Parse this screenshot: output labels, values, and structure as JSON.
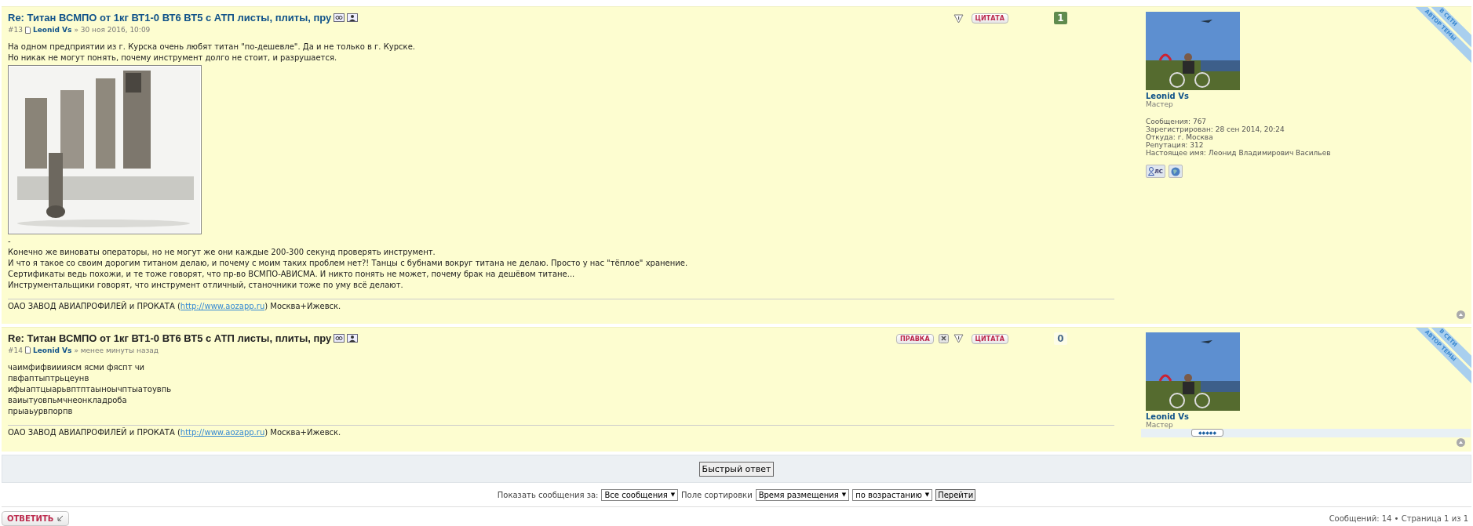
{
  "posts": [
    {
      "title": "Re: Титан ВСМПО от 1кг ВТ1-0 ВТ6 ВТ5 с АТП листы, плиты, пру",
      "title_highlighted": true,
      "number": "#13",
      "author": "Leonid Vs",
      "date": "» 30 ноя 2016, 10:09",
      "actions": [
        {
          "kind": "report"
        },
        {
          "kind": "quote",
          "label": "ЦИТАТА"
        }
      ],
      "score": {
        "text": "1",
        "positive": true
      },
      "body": [
        {
          "kind": "text",
          "text": "На одном предприятии из г. Курска очень любят титан \"по-дешевле\". Да и не только в г. Курске."
        },
        {
          "kind": "text",
          "text": "Но никак не могут понять, почему инструмент долго не стоит, и разрушается."
        },
        {
          "kind": "picture"
        },
        {
          "kind": "gap"
        },
        {
          "kind": "text",
          "text": "-"
        },
        {
          "kind": "text",
          "text": "Конечно же виноваты операторы, но не могут же они каждые 200-300 секунд проверять инструмент."
        },
        {
          "kind": "text",
          "text": "И что я такое со своим дорогим титаном делаю, и почему с моим таких проблем нет?! Танцы с бубнами вокруг титана не делаю. Просто у нас \"тёплое\" хранение."
        },
        {
          "kind": "text",
          "text": "Сертификаты ведь похожи, и те тоже говорят, что пр-во ВСМПО-АВИСМА. И никто понять не может, почему брак на дешёвом титане..."
        },
        {
          "kind": "text",
          "text": "Инструментальщики говорят, что инструмент отличный, станочники тоже по уму всё делают."
        }
      ],
      "signature": {
        "before": "ОАО ЗАВОД АВИАПРОФИЛЕЙ и ПРОКАТА (",
        "link": "http://www.aozapp.ru",
        "after": ") Москва+Ижевск."
      },
      "profile": {
        "name": "Leonid Vs",
        "rank": "Мастер",
        "details": [
          "Сообщения: 767",
          "Зарегистрирован: 28 сен 2014, 20:24",
          "Откуда: г. Москва",
          "Репутация: 312",
          "Настоящее имя: Леонид Владимирович Васильев"
        ],
        "contact_buttons": [
          {
            "kind": "pm",
            "label": "ЛС"
          },
          {
            "kind": "web"
          }
        ]
      },
      "ribbon": [
        "В СЕТИ",
        "АВТОР ТЕМЫ"
      ]
    },
    {
      "title": "Re: Титан ВСМПО от 1кг ВТ1-0 ВТ6 ВТ5 с АТП листы, плиты, пру",
      "title_highlighted": false,
      "number": "#14",
      "author": "Leonid Vs",
      "date": "» менее минуты назад",
      "actions": [
        {
          "kind": "edit",
          "label": "ПРАВКА"
        },
        {
          "kind": "delete"
        },
        {
          "kind": "report"
        },
        {
          "kind": "quote",
          "label": "ЦИТАТА"
        }
      ],
      "score": {
        "text": "0",
        "positive": false
      },
      "body": [
        {
          "kind": "text",
          "text": "чаимфифвиииясм ясми фяспт чи"
        },
        {
          "kind": "text",
          "text": "пвфаптыптрьцеунв"
        },
        {
          "kind": "text",
          "text": "ифыаптцыарьвптптаыноычптыатоувпь"
        },
        {
          "kind": "text",
          "text": "ваиытуовпьмчнеонкладроба"
        },
        {
          "kind": "text",
          "text": "прыаьурвпорпв"
        }
      ],
      "signature": {
        "before": "ОАО ЗАВОД АВИАПРОФИЛЕЙ и ПРОКАТА (",
        "link": "http://www.aozapp.ru",
        "after": ") Москва+Ижевск."
      },
      "profile": {
        "name": "Leonid Vs",
        "rank": "Мастер",
        "rating": "◆◆◆◆◆"
      },
      "ribbon": [
        "В СЕТИ",
        "АВТОР ТЕМЫ"
      ]
    }
  ],
  "quick_reply": "Быстрый ответ",
  "sort_bar": {
    "show_label": "Показать сообщения за:",
    "show_value": "Все сообщения",
    "sort_label": "Поле сортировки",
    "sort_value": "Время размещения",
    "order_value": "по возрастанию",
    "go": "Перейти",
    "caret": "▼"
  },
  "reply_button": "ОТВЕТИТЬ",
  "pagination": "Сообщений: 14 • Страница 1 из 1"
}
